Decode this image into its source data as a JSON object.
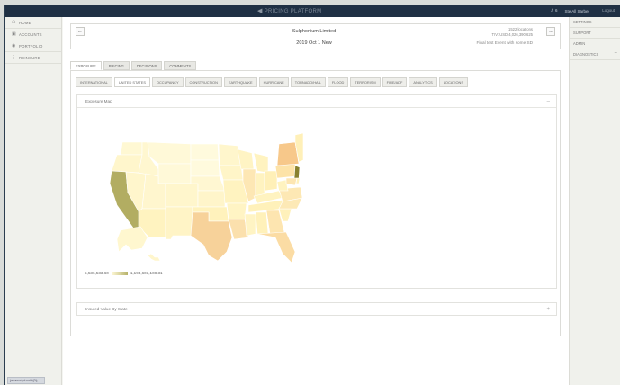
{
  "topbar": {
    "brand": "PRICING PLATFORM",
    "user_count": "6",
    "user_name": "Ste All Sarber",
    "logout_label": "Logout"
  },
  "leftnav": {
    "items": [
      {
        "icon": "home-icon",
        "label": "HOME"
      },
      {
        "icon": "accounts-icon",
        "label": "ACCOUNTS"
      },
      {
        "icon": "portfolio-icon",
        "label": "PORTFOLIO"
      },
      {
        "icon": "reinsure-icon",
        "label": "REINSURE"
      }
    ],
    "footer_text": "javascript:void(0);"
  },
  "rightnav": {
    "items": [
      {
        "label": "SETTINGS"
      },
      {
        "label": "SUPPORT"
      },
      {
        "label": "ADMIN"
      },
      {
        "label": "DIAGNOSTICS",
        "expand": "+"
      }
    ]
  },
  "header": {
    "prev_label": "←",
    "next_label": "→",
    "title": "Sulphonium Limited",
    "subtitle": "2019 Oct 1 New",
    "locations": "1522 locations",
    "tiv": "TIV: USD 4,026,390,625",
    "description": "Final test Event with some SD"
  },
  "tabs": [
    "EXPOSURE",
    "PRICING",
    "DECISIONS",
    "COMMENTS"
  ],
  "subtabs": [
    "INTERNATIONAL",
    "UNITED STATES",
    "OCCUPANCY",
    "CONSTRUCTION",
    "EARTHQUAKE",
    "HURRICANE",
    "TORNADO/HAIL",
    "FLOOD",
    "TERRORISM",
    "FIRE/ADF",
    "ANALYTICS",
    "LOCATIONS"
  ],
  "exposure_map": {
    "title": "Exposure Map",
    "collapse_icon": "minus",
    "legend_min": "5,536,533.60",
    "legend_max": "1,193,603,108.31",
    "colors": {
      "low": "#fff9d8",
      "high": "#b7b26a"
    }
  },
  "insured_value": {
    "title": "Insured Value By State",
    "expand_icon": "plus"
  }
}
